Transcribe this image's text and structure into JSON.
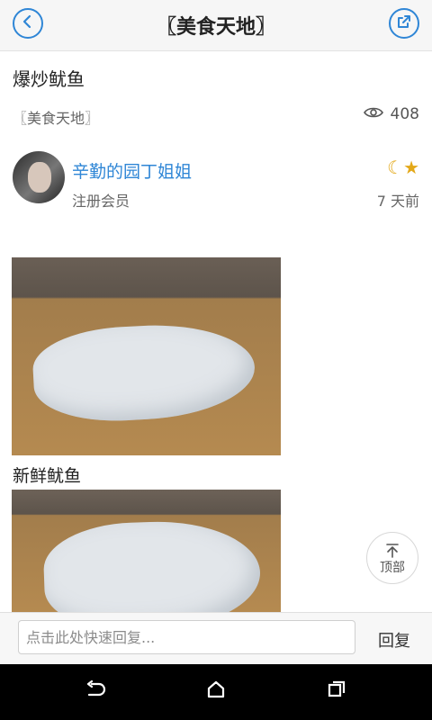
{
  "header": {
    "title": "〖美食天地〗",
    "back_icon": "back-icon",
    "share_icon": "share-icon"
  },
  "post": {
    "title": "爆炒鱿鱼",
    "forum": "〖美食天地〗",
    "views": "408",
    "author": {
      "name": "辛勤的园丁姐姐",
      "role": "注册会员",
      "time": "7 天前"
    },
    "image_caption": "新鲜鱿鱼"
  },
  "to_top": {
    "label": "顶部"
  },
  "reply": {
    "placeholder": "点击此处快速回复...",
    "button": "回复"
  },
  "colors": {
    "accent": "#2f86d6",
    "badge": "#e3a818"
  }
}
